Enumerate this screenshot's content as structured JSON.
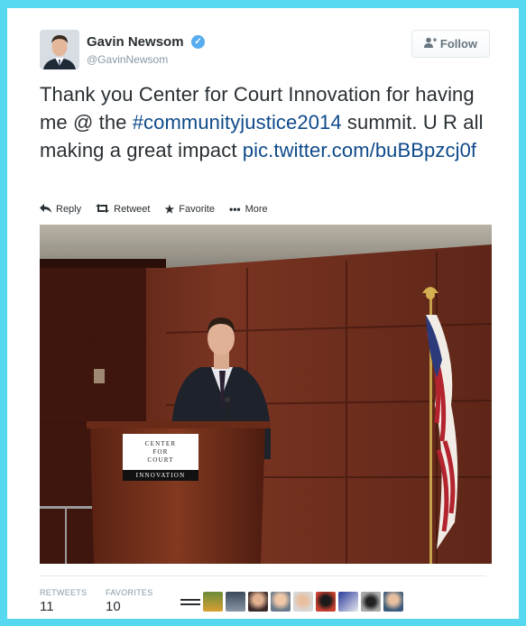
{
  "author": {
    "name": "Gavin Newsom",
    "handle": "@GavinNewsom",
    "verified_icon": "verified-badge-icon"
  },
  "follow_button": {
    "label": "Follow",
    "icon": "add-user-icon"
  },
  "tweet": {
    "text_before": "Thank you Center for Court Innovation for having me @ the ",
    "hashtag": "#communityjustice2014",
    "text_after": " summit. U R all making a great impact ",
    "link": "pic.twitter.com/buBBpzcj0f"
  },
  "actions": [
    {
      "label": "Reply",
      "icon": "reply-icon"
    },
    {
      "label": "Retweet",
      "icon": "retweet-icon"
    },
    {
      "label": "Favorite",
      "icon": "star-icon"
    },
    {
      "label": "More",
      "icon": "more-dots-icon"
    }
  ],
  "photo": {
    "podium_sign": [
      "CENTER",
      "FOR",
      "COURT",
      "INNOVATION"
    ]
  },
  "stats": {
    "retweets_label": "RETWEETS",
    "retweets_value": "11",
    "favorites_label": "FAVORITES",
    "favorites_value": "10"
  },
  "colors": {
    "frame": "#55d8f0",
    "link": "#0e4a8a",
    "verified": "#55acee"
  }
}
